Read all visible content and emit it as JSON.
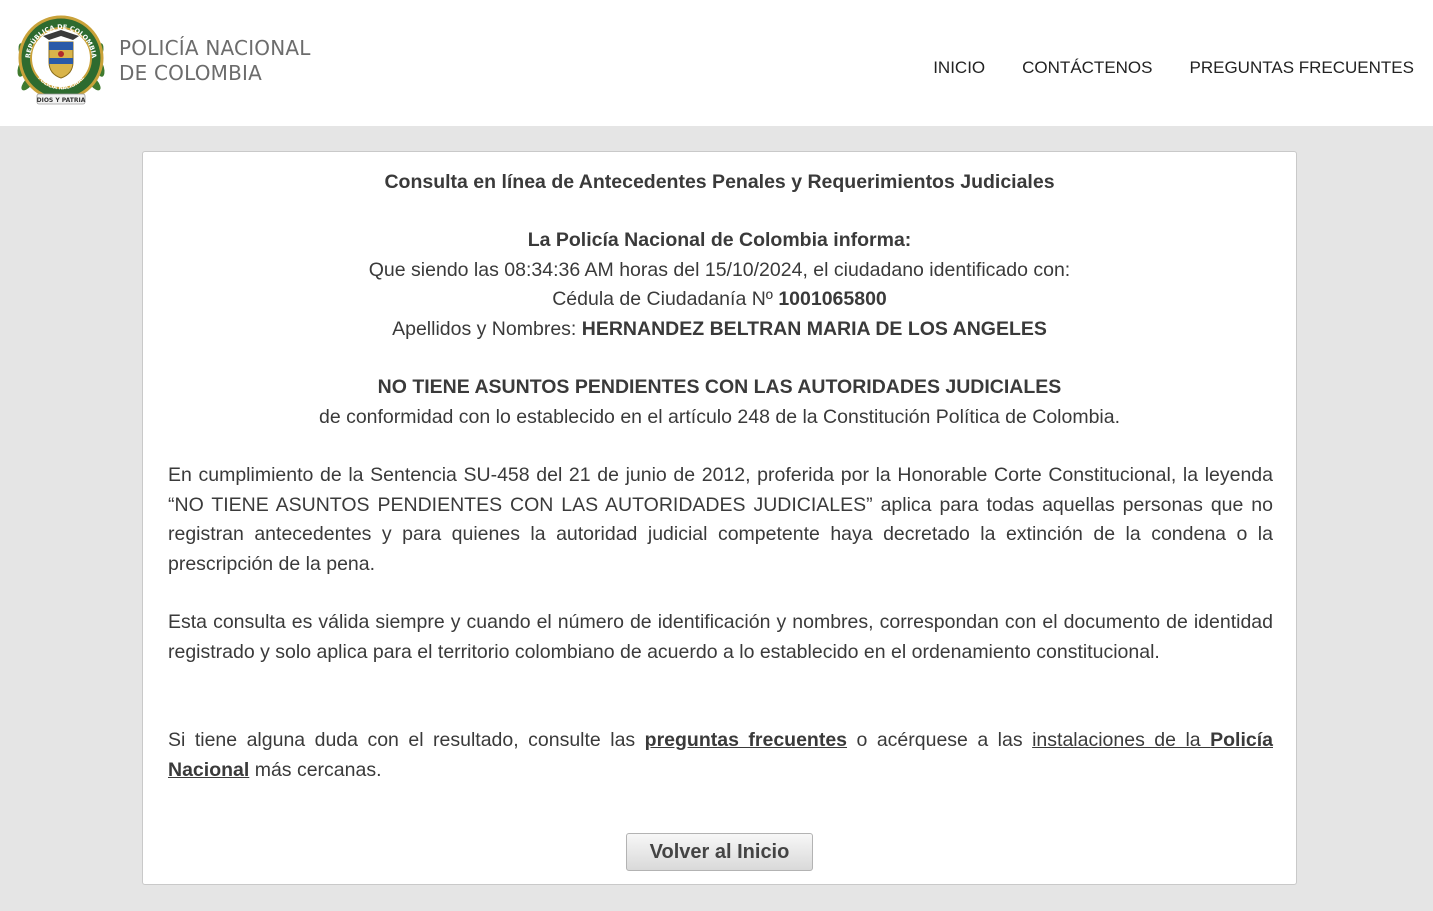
{
  "header": {
    "brand_line1": "POLICÍA NACIONAL",
    "brand_line2": "DE COLOMBIA",
    "logo": {
      "icon": "police-emblem-icon",
      "ring_text_top": "REPÚBLICA DE COLOMBIA",
      "ring_text_bottom": "POLICÍA NACIONAL",
      "ribbon_text": "DIOS Y PATRIA"
    },
    "nav": {
      "inicio": "INICIO",
      "contactenos": "CONTÁCTENOS",
      "preguntas": "PREGUNTAS FRECUENTES"
    }
  },
  "result": {
    "title": "Consulta en línea de Antecedentes Penales y Requerimientos Judiciales",
    "informa": "La Policía Nacional de Colombia informa:",
    "line_time_prefix": "Que siendo las ",
    "time": "08:34:36 AM",
    "line_time_mid": " horas del ",
    "date": "15/10/2024",
    "line_time_suffix": ", el ciudadano identificado con:",
    "id_label": "Cédula de Ciudadanía Nº ",
    "id_number": "1001065800",
    "names_label": "Apellidos y Nombres: ",
    "names_value": "HERNANDEZ BELTRAN MARIA DE LOS ANGELES",
    "status": "NO TIENE ASUNTOS PENDIENTES CON LAS AUTORIDADES JUDICIALES",
    "status_note": "de conformidad con lo establecido en el artículo 248 de la Constitución Política de Colombia.",
    "para1": "En cumplimiento de la Sentencia SU-458 del 21 de junio de 2012, proferida por la Honorable Corte Constitucional, la leyenda “NO TIENE ASUNTOS PENDIENTES CON LAS AUTORIDADES JUDICIALES” aplica para todas aquellas personas que no registran antecedentes y para quienes la autoridad judicial competente haya decretado la extinción de la condena o la prescripción de la pena.",
    "para2": "Esta consulta es válida siempre y cuando el número de identificación y nombres, correspondan con el documento de identidad registrado y solo aplica para el territorio colombiano de acuerdo a lo establecido en el ordenamiento constitucional.",
    "para3_a": "Si tiene alguna duda con el resultado, consulte las ",
    "link_faq": "preguntas frecuentes",
    "para3_b": " o acérquese a las ",
    "link_inst_a": "instalaciones de la ",
    "link_inst_b": "Policía Nacional",
    "para3_c": " más cercanas.",
    "button": "Volver al Inicio"
  },
  "colors": {
    "page_bg": "#e5e5e5",
    "text": "#3a3a3a",
    "emblem_green": "#2e6b2f",
    "emblem_gold": "#c9a23a"
  }
}
